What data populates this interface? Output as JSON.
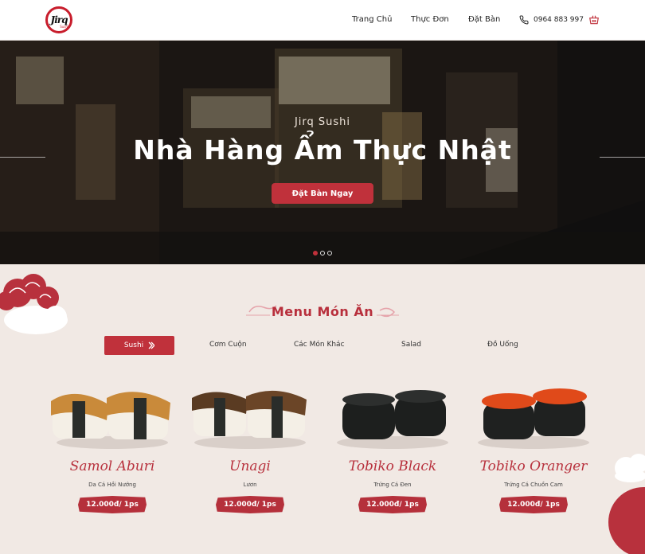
{
  "header": {
    "logo_text": "Jirq",
    "logo_sub": "Sushi",
    "nav": [
      "Trang Chủ",
      "Thực Đơn",
      "Đặt Bàn"
    ],
    "phone": "0964 883 997"
  },
  "hero": {
    "subtitle": "Jirq Sushi",
    "title": "Nhà Hàng Ẩm Thực Nhật",
    "button": "Đặt Bàn Ngay",
    "slides": 3,
    "active_slide": 1
  },
  "menu": {
    "title": "Menu Món Ăn",
    "tabs": [
      "Sushi",
      "Cơm Cuộn",
      "Các Món Khác",
      "Salad",
      "Đồ Uống"
    ],
    "active_tab": "Sushi",
    "items": [
      {
        "name": "Samol Aburi",
        "desc": "Da Cá Hồi Nướng",
        "price": "12.000đ/ 1ps"
      },
      {
        "name": "Unagi",
        "desc": "Lươn",
        "price": "12.000đ/ 1ps"
      },
      {
        "name": "Tobiko Black",
        "desc": "Trứng Cá Đen",
        "price": "12.000đ/ 1ps"
      },
      {
        "name": "Tobiko  Oranger",
        "desc": "Trứng Cá Chuồn Cam",
        "price": "12.000đ/ 1ps"
      }
    ]
  },
  "colors": {
    "accent": "#c0313b",
    "background": "#f1e9e4"
  }
}
